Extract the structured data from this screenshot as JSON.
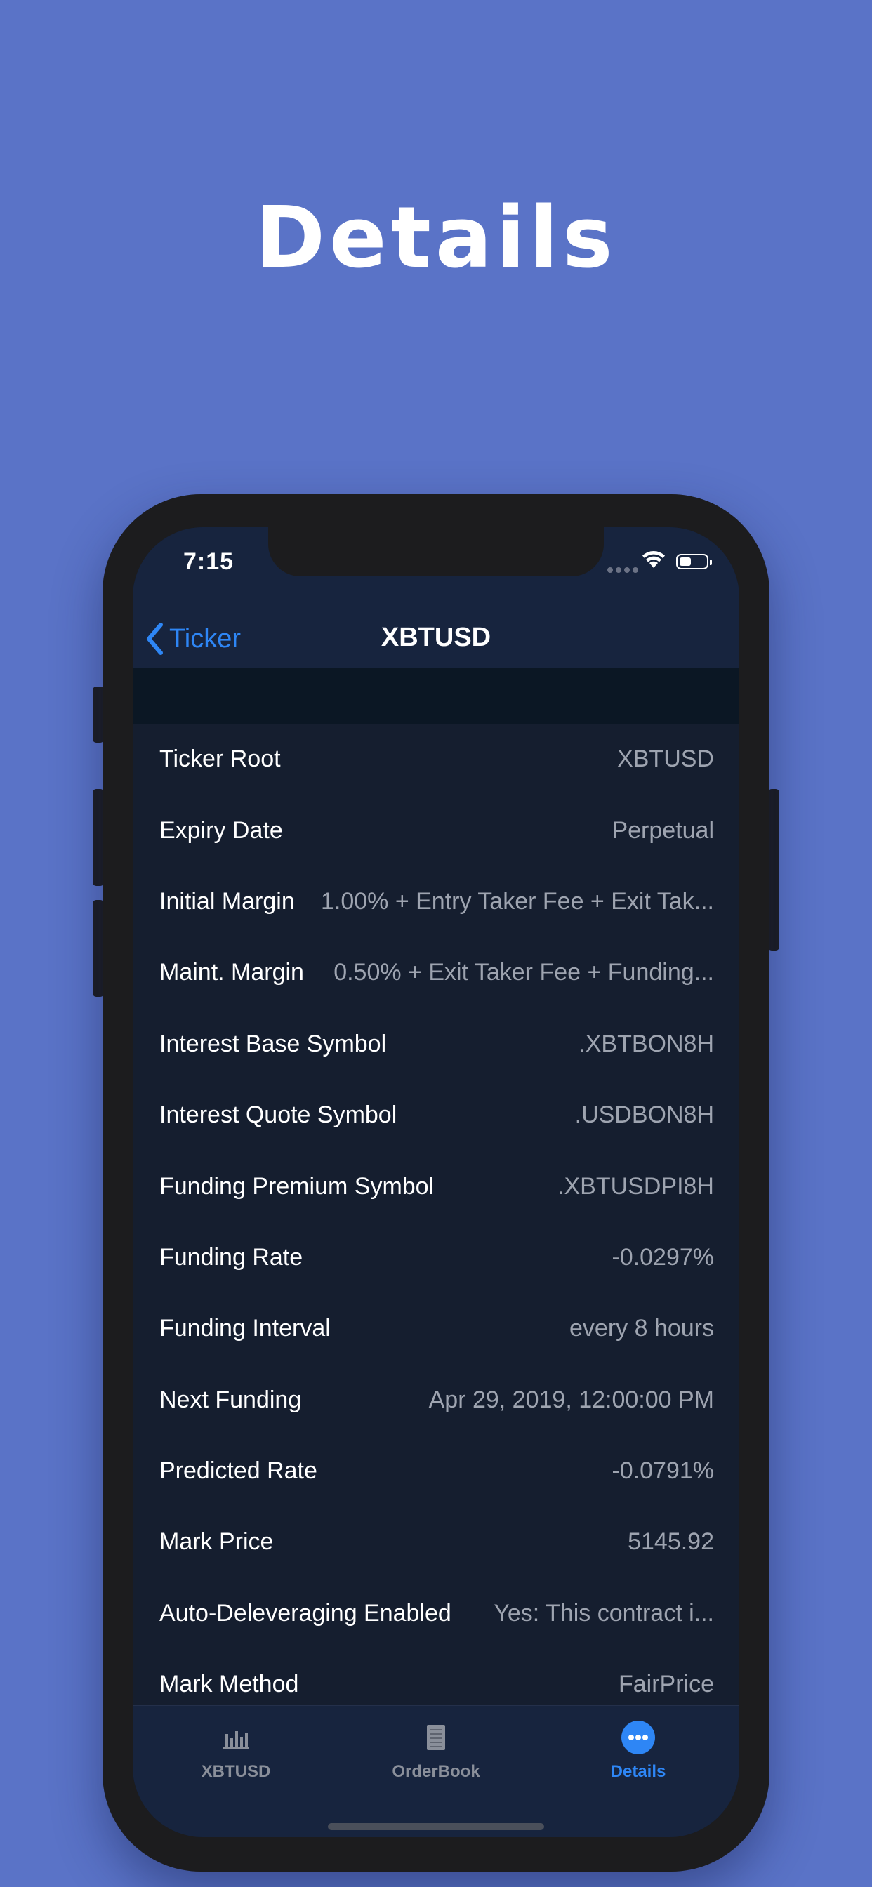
{
  "hero": {
    "title": "Details"
  },
  "status_bar": {
    "time": "7:15"
  },
  "nav": {
    "back_label": "Ticker",
    "title": "XBTUSD"
  },
  "rows": [
    {
      "label": "Ticker Root",
      "value": "XBTUSD"
    },
    {
      "label": "Expiry Date",
      "value": "Perpetual"
    },
    {
      "label": "Initial Margin",
      "value": "1.00% + Entry Taker Fee + Exit Tak..."
    },
    {
      "label": "Maint. Margin",
      "value": "0.50% + Exit Taker Fee + Funding..."
    },
    {
      "label": "Interest Base Symbol",
      "value": ".XBTBON8H"
    },
    {
      "label": "Interest Quote Symbol",
      "value": ".USDBON8H"
    },
    {
      "label": "Funding Premium Symbol",
      "value": ".XBTUSDPI8H"
    },
    {
      "label": "Funding Rate",
      "value": "-0.0297%"
    },
    {
      "label": "Funding Interval",
      "value": "every 8 hours"
    },
    {
      "label": "Next Funding",
      "value": "Apr 29, 2019, 12:00:00 PM"
    },
    {
      "label": "Predicted Rate",
      "value": "-0.0791%"
    },
    {
      "label": "Mark Price",
      "value": "5145.92"
    },
    {
      "label": "Auto-Deleveraging Enabled",
      "value": "Yes: This contract i..."
    },
    {
      "label": "Mark Method",
      "value": "FairPrice"
    }
  ],
  "tabbar": {
    "tabs": [
      {
        "label": "XBTUSD",
        "icon": "bar-chart-icon",
        "selected": false
      },
      {
        "label": "OrderBook",
        "icon": "document-icon",
        "selected": false
      },
      {
        "label": "Details",
        "icon": "more-icon",
        "selected": true
      }
    ]
  },
  "colors": {
    "background": "#5a73c7",
    "accent": "#2e86f5",
    "screen": "#151e2f",
    "navbar": "#17243e"
  }
}
